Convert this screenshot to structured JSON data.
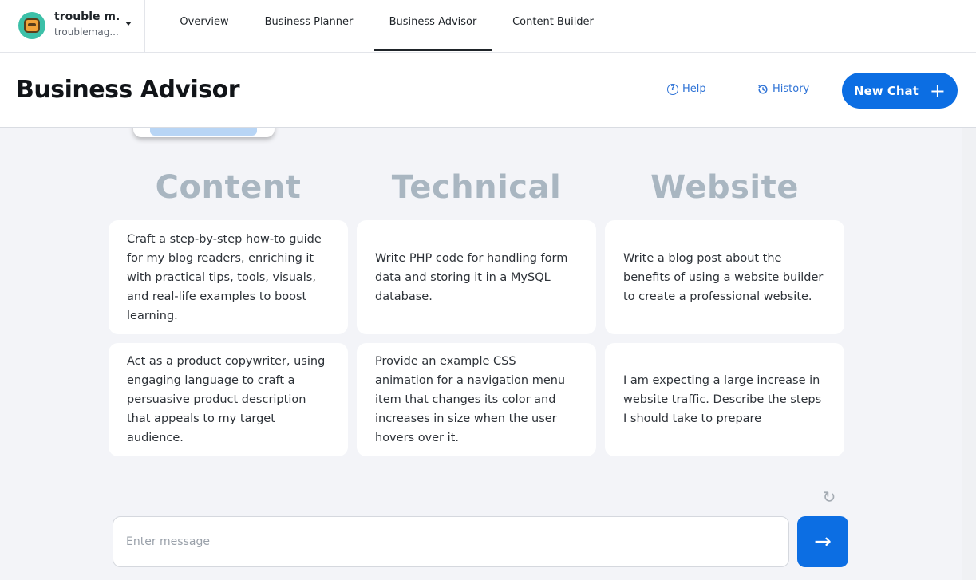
{
  "account": {
    "name": "trouble m...",
    "subtitle": "troublemag..."
  },
  "nav": {
    "tabs": [
      {
        "label": "Overview"
      },
      {
        "label": "Business Planner"
      },
      {
        "label": "Business Advisor"
      },
      {
        "label": "Content Builder"
      }
    ],
    "active_tab": "Business Advisor"
  },
  "header": {
    "title": "Business Advisor",
    "help_label": "Help",
    "history_label": "History",
    "new_chat_label": "New Chat"
  },
  "categories": [
    {
      "heading": "Content",
      "prompts": [
        "Craft a step-by-step how-to guide for my blog readers, enriching it with practical tips, tools, visuals, and real-life examples to boost learning.",
        "Act as a product copywriter, using engaging language to craft a persuasive product description that appeals to my target audience."
      ]
    },
    {
      "heading": "Technical",
      "prompts": [
        "Write PHP code for handling form data and storing it in a MySQL database.",
        "Provide an example CSS animation for a navigation menu item that changes its color and increases in size when the user hovers over it."
      ]
    },
    {
      "heading": "Website",
      "prompts": [
        "Write a blog post about the benefits of using a website builder to create a professional website.",
        "I am expecting a large increase in website traffic. Describe the steps I should take to prepare"
      ]
    }
  ],
  "composer": {
    "placeholder": "Enter message"
  },
  "colors": {
    "accent": "#0c6ee3",
    "link": "#2f73d6",
    "category_heading": "#a9b6c1",
    "background": "#f3f4f8"
  },
  "icons": {
    "help": "question-circle-icon",
    "history": "history-clock-icon",
    "new_chat": "plus-icon",
    "refresh": "refresh-icon",
    "send": "arrow-right-icon",
    "account_menu": "caret-down-icon"
  }
}
